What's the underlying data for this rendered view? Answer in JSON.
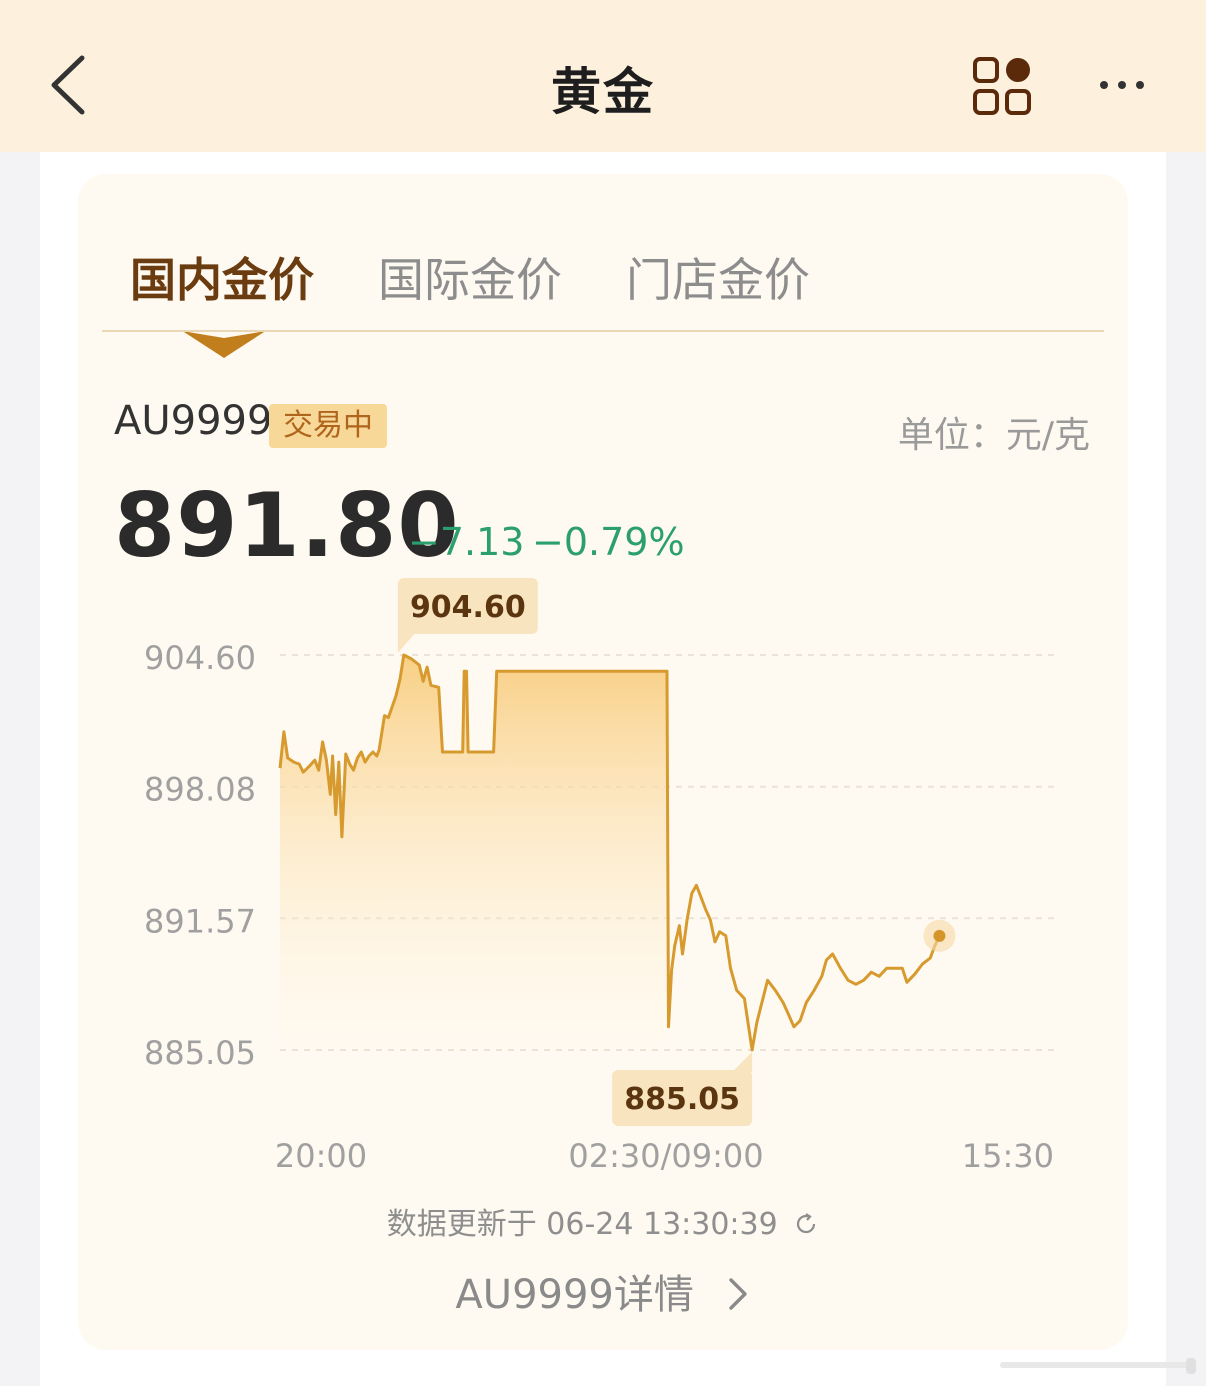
{
  "header": {
    "title": "黄金",
    "back_icon": "chevron-left-icon",
    "apps_icon": "apps-grid-icon",
    "more_icon": "more-dots-icon"
  },
  "tabs": [
    {
      "label": "国内金价",
      "active": true
    },
    {
      "label": "国际金价",
      "active": false
    },
    {
      "label": "门店金价",
      "active": false
    }
  ],
  "quote": {
    "symbol": "AU9999",
    "status_badge": "交易中",
    "unit": "单位：元/克",
    "price": "891.80",
    "change": "−7.13",
    "change_percent": "−0.79%",
    "change_color": "#2c9f6f"
  },
  "footer": {
    "updated": "数据更新于 06-24 13:30:39",
    "refresh_icon": "refresh-icon",
    "detail_link": "AU9999详情",
    "detail_icon": "chevron-right-icon"
  },
  "colors": {
    "accent": "#d4962b",
    "header_bg": "#fdf1dd",
    "card_bg": "#fffaf1"
  },
  "chart_data": {
    "type": "area",
    "y_ticks": [
      "904.60",
      "898.08",
      "891.57",
      "885.05"
    ],
    "x_ticks": [
      "20:00",
      "02:30/09:00",
      "15:30"
    ],
    "ylim": [
      885.05,
      904.6
    ],
    "high_label": "904.60",
    "low_label": "885.05",
    "grid": "dashed horizontal",
    "series": [
      {
        "values": [
          [
            0.0,
            899.0
          ],
          [
            0.005,
            900.8
          ],
          [
            0.01,
            899.5
          ],
          [
            0.018,
            899.3
          ],
          [
            0.025,
            899.2
          ],
          [
            0.03,
            898.8
          ],
          [
            0.038,
            899.1
          ],
          [
            0.045,
            899.4
          ],
          [
            0.05,
            898.9
          ],
          [
            0.055,
            900.3
          ],
          [
            0.06,
            899.4
          ],
          [
            0.065,
            897.7
          ],
          [
            0.068,
            899.6
          ],
          [
            0.072,
            896.7
          ],
          [
            0.076,
            899.3
          ],
          [
            0.08,
            895.6
          ],
          [
            0.085,
            899.7
          ],
          [
            0.09,
            899.2
          ],
          [
            0.095,
            898.9
          ],
          [
            0.1,
            899.5
          ],
          [
            0.105,
            899.8
          ],
          [
            0.11,
            899.3
          ],
          [
            0.115,
            899.6
          ],
          [
            0.12,
            899.8
          ],
          [
            0.125,
            899.6
          ],
          [
            0.128,
            899.9
          ],
          [
            0.135,
            901.6
          ],
          [
            0.14,
            901.5
          ],
          [
            0.15,
            902.6
          ],
          [
            0.155,
            903.4
          ],
          [
            0.16,
            904.6
          ],
          [
            0.17,
            904.4
          ],
          [
            0.18,
            904.1
          ],
          [
            0.185,
            903.3
          ],
          [
            0.19,
            904.0
          ],
          [
            0.195,
            903.1
          ],
          [
            0.205,
            903.0
          ],
          [
            0.21,
            899.8
          ],
          [
            0.22,
            899.8
          ],
          [
            0.228,
            899.8
          ],
          [
            0.236,
            899.8
          ],
          [
            0.238,
            903.8
          ],
          [
            0.241,
            903.8
          ],
          [
            0.243,
            899.8
          ],
          [
            0.262,
            899.8
          ],
          [
            0.276,
            899.8
          ],
          [
            0.28,
            903.8
          ],
          [
            0.48,
            903.8
          ],
          [
            0.5,
            903.8
          ],
          [
            0.502,
            886.2
          ],
          [
            0.506,
            889.0
          ],
          [
            0.51,
            890.2
          ],
          [
            0.516,
            891.2
          ],
          [
            0.52,
            889.8
          ],
          [
            0.526,
            891.5
          ],
          [
            0.532,
            892.8
          ],
          [
            0.538,
            893.2
          ],
          [
            0.544,
            892.6
          ],
          [
            0.55,
            892.0
          ],
          [
            0.556,
            891.5
          ],
          [
            0.562,
            890.4
          ],
          [
            0.568,
            890.9
          ],
          [
            0.576,
            890.7
          ],
          [
            0.582,
            889.1
          ],
          [
            0.59,
            888.0
          ],
          [
            0.6,
            887.6
          ],
          [
            0.61,
            885.05
          ],
          [
            0.616,
            886.4
          ],
          [
            0.622,
            887.3
          ],
          [
            0.63,
            888.5
          ],
          [
            0.64,
            888.0
          ],
          [
            0.65,
            887.4
          ],
          [
            0.656,
            886.9
          ],
          [
            0.664,
            886.2
          ],
          [
            0.672,
            886.5
          ],
          [
            0.68,
            887.4
          ],
          [
            0.69,
            888.0
          ],
          [
            0.7,
            888.7
          ],
          [
            0.706,
            889.5
          ],
          [
            0.714,
            889.8
          ],
          [
            0.724,
            889.1
          ],
          [
            0.734,
            888.5
          ],
          [
            0.744,
            888.3
          ],
          [
            0.754,
            888.5
          ],
          [
            0.764,
            888.9
          ],
          [
            0.774,
            888.7
          ],
          [
            0.784,
            889.1
          ],
          [
            0.794,
            889.1
          ],
          [
            0.804,
            889.1
          ],
          [
            0.81,
            888.4
          ],
          [
            0.82,
            888.8
          ],
          [
            0.83,
            889.3
          ],
          [
            0.84,
            889.6
          ],
          [
            0.846,
            890.2
          ],
          [
            0.852,
            890.7
          ]
        ]
      }
    ]
  }
}
